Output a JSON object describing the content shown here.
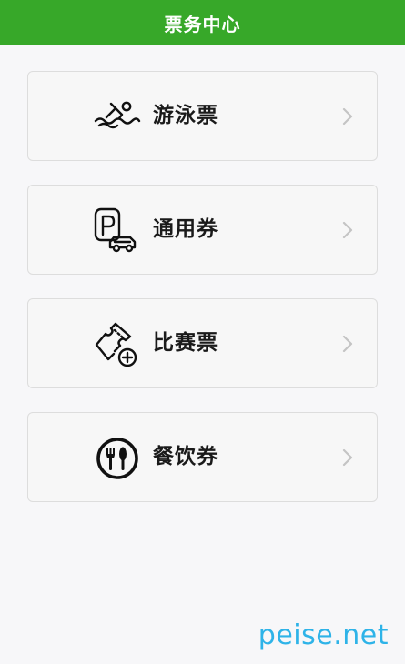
{
  "header": {
    "title": "票务中心"
  },
  "cards": [
    {
      "label": "游泳票",
      "icon": "swimmer-icon"
    },
    {
      "label": "通用券",
      "icon": "parking-car-icon"
    },
    {
      "label": "比赛票",
      "icon": "ticket-plus-icon"
    },
    {
      "label": "餐饮券",
      "icon": "dining-icon"
    }
  ],
  "watermark": {
    "text": "peise.net"
  },
  "colors": {
    "header_bg": "#37a829",
    "background": "#f7f7f9",
    "card_border": "#dddddd",
    "watermark": "#2eb3e8"
  }
}
